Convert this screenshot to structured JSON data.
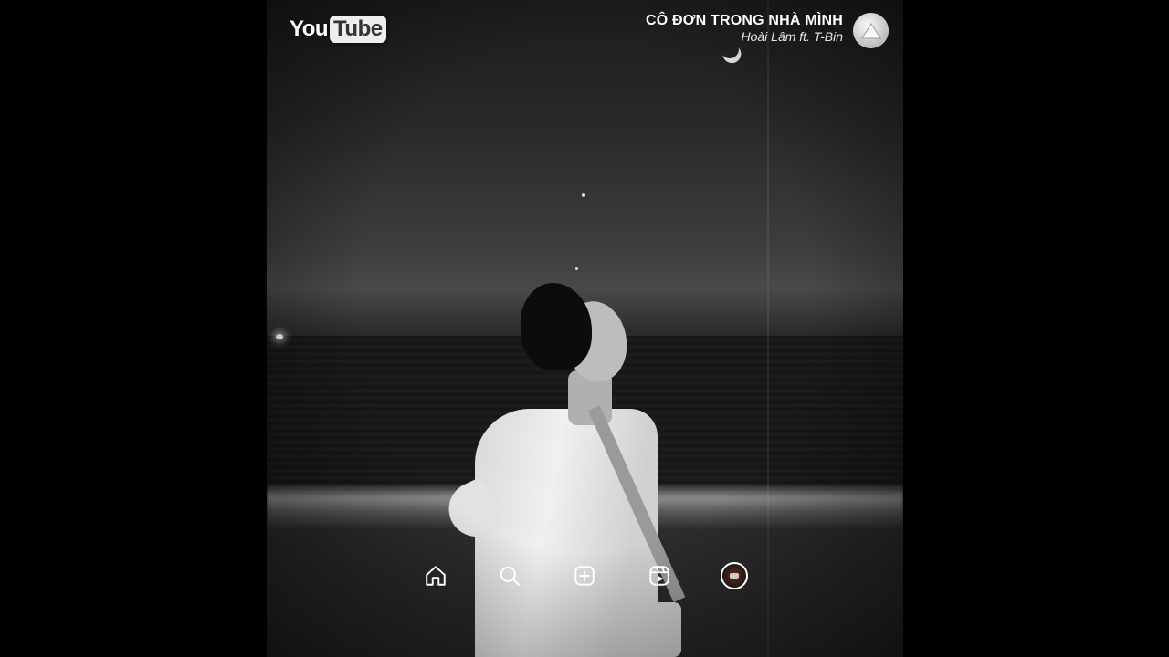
{
  "platform_logo": {
    "part1": "You",
    "part2": "Tube"
  },
  "song": {
    "title": "CÔ ĐƠN TRONG NHÀ MÌNH",
    "artist": "Hoài Lâm ft. T-Bin"
  },
  "channel": {
    "icon": "triangle-logo-icon"
  },
  "nav": [
    {
      "icon": "home-icon"
    },
    {
      "icon": "search-icon"
    },
    {
      "icon": "add-post-icon"
    },
    {
      "icon": "reels-icon"
    },
    {
      "icon": "profile-avatar-icon"
    }
  ],
  "colors": {
    "background": "#000000",
    "text": "#ffffff"
  }
}
